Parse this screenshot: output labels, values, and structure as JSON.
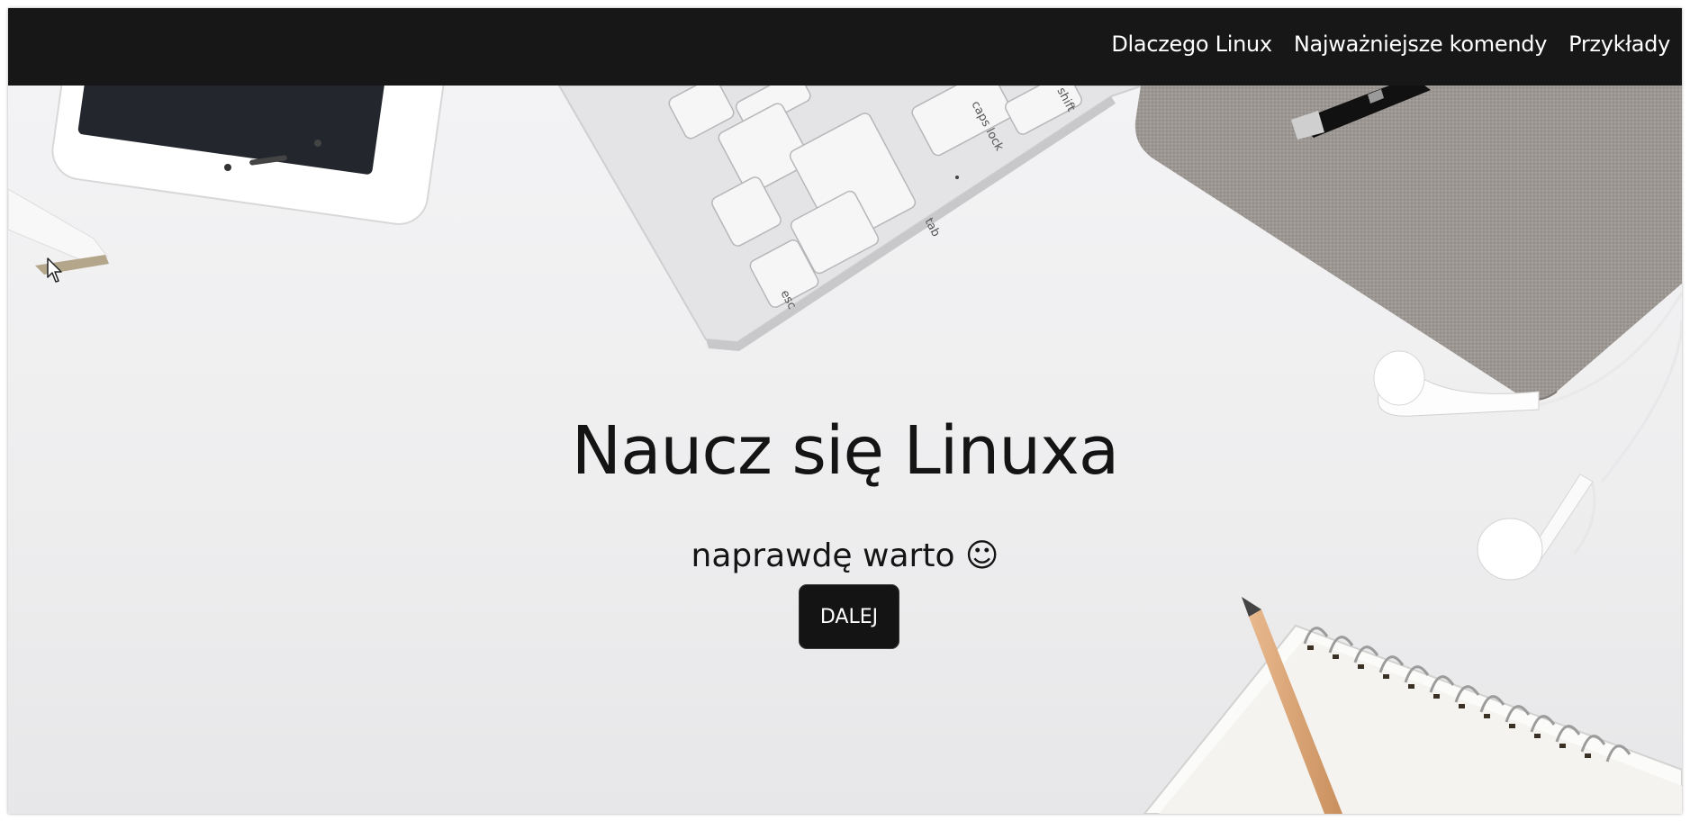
{
  "navbar": {
    "links": [
      "Dlaczego Linux",
      "Najważniejsze komendy",
      "Przykłady"
    ]
  },
  "hero": {
    "title": "Naucz się Linuxa",
    "subtitle": "naprawdę warto ☺",
    "button_label": "DALEJ"
  },
  "keyboard_keys": [
    "esc",
    "tab",
    "caps lock",
    "shift"
  ],
  "colors": {
    "navbar_bg": "#171717",
    "button_bg": "#141414",
    "hero_bg": "#ededee",
    "text_dark": "#141414",
    "text_light": "#ffffff"
  },
  "icons": [
    "smiley-icon",
    "pointer-cursor-icon"
  ]
}
